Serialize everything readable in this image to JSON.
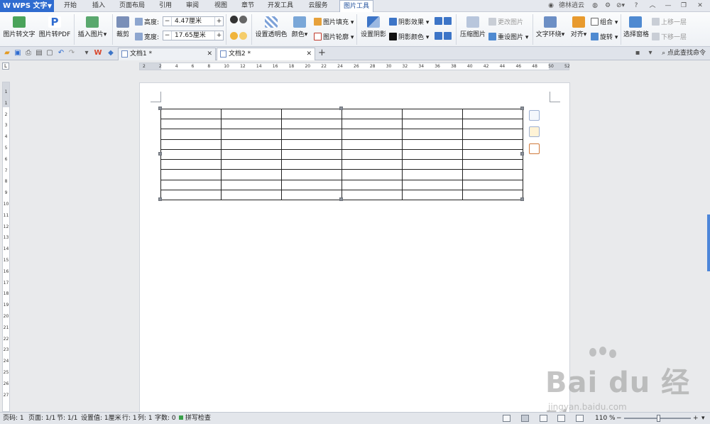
{
  "app": {
    "name": "WPS 文字"
  },
  "menu_tabs": [
    "开始",
    "插入",
    "页面布局",
    "引用",
    "审阅",
    "视图",
    "章节",
    "开发工具",
    "云服务",
    "图片工具"
  ],
  "title_right": {
    "user": "德林逍云",
    "help": "?"
  },
  "ribbon": {
    "pic_to_text": "图片转文字",
    "pic_to_pdf": "图片转PDF",
    "insert_pic": "插入图片",
    "crop": "裁剪",
    "height_label": "高度:",
    "height_value": "4.47厘米",
    "width_label": "宽度:",
    "width_value": "17.65厘米",
    "set_transparent": "设置透明色",
    "color": "颜色",
    "pic_fill": "图片填充",
    "pic_outline": "图片轮廓",
    "set_shadow": "设置阴影",
    "shadow_effect": "阴影效果",
    "shadow_color": "阴影颜色",
    "compress": "压缩图片",
    "change_pic": "更改图片",
    "reset_pic": "重设图片",
    "wrap": "文字环绕",
    "align": "对齐",
    "group": "组合",
    "rotate": "旋转",
    "selection_pane": "选择窗格",
    "bring_forward": "上移一层",
    "send_backward": "下移一层"
  },
  "doc_tabs": [
    {
      "label": "文档1 *"
    },
    {
      "label": "文档2 *"
    }
  ],
  "search_cmd": "点此查找命令",
  "hruler_ticks": [
    "2",
    "2",
    "4",
    "6",
    "8",
    "10",
    "12",
    "14",
    "16",
    "18",
    "20",
    "22",
    "24",
    "26",
    "28",
    "30",
    "32",
    "34",
    "36",
    "38",
    "40",
    "42",
    "44",
    "46",
    "48",
    "50",
    "52"
  ],
  "vruler_ticks": [
    "1",
    "1",
    "2",
    "3",
    "4",
    "5",
    "6",
    "7",
    "8",
    "9",
    "10",
    "11",
    "12",
    "13",
    "14",
    "15",
    "16",
    "17",
    "18",
    "19",
    "20",
    "21",
    "22",
    "23",
    "24",
    "25",
    "26",
    "27"
  ],
  "table": {
    "rows": 9,
    "cols": 6
  },
  "statusbar": {
    "page_num": "页码: 1",
    "pages": "页面: 1/1",
    "section": "节: 1/1",
    "setting": "设置值: 1厘米",
    "row": "行: 1",
    "col": "列: 1",
    "word_count": "字数: 0",
    "spell_check": "拼写检查",
    "zoom": "110 %"
  },
  "watermark": {
    "main": "Bai du 经验",
    "sub": "jingyan.baidu.com"
  },
  "colors": {
    "accent": "#2f6cd0",
    "scroll_thumb": "#4d86d9"
  }
}
